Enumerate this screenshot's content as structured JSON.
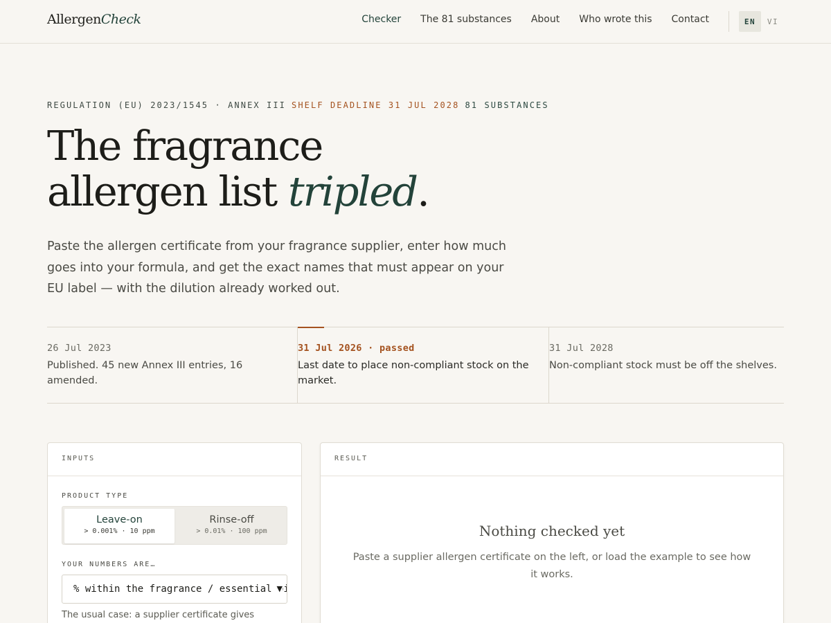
{
  "brand": {
    "name": "Allergen",
    "accent": "Check"
  },
  "nav": {
    "items": [
      {
        "label": "Checker",
        "active": true
      },
      {
        "label": "The 81 substances"
      },
      {
        "label": "About"
      },
      {
        "label": "Who wrote this"
      },
      {
        "label": "Contact"
      }
    ],
    "languages": [
      {
        "code": "EN",
        "selected": true
      },
      {
        "code": "VI"
      }
    ]
  },
  "hero": {
    "meta": {
      "regulation": "REGULATION (EU) 2023/1545 · ANNEX III",
      "deadline": "SHELF DEADLINE 31 JUL 2028",
      "count": "81 SUBSTANCES"
    },
    "title_line1": "The fragrance",
    "title_line2_prefix": "allergen list ",
    "title_italic": "tripled",
    "title_period": ".",
    "description": "Paste the allergen certificate from your fragrance supplier, enter how much goes into your formula, and get the exact names that must appear on your EU label — with the dilution already worked out."
  },
  "timeline": [
    {
      "date": "26 Jul 2023",
      "text": "Published. 45 new Annex III entries, 16 amended."
    },
    {
      "date": "31 Jul 2026 · passed",
      "text": "Last date to place non-compliant stock on the market."
    },
    {
      "date": "31 Jul 2028",
      "text": "Non-compliant stock must be off the shelves."
    }
  ],
  "inputs_panel": {
    "heading": "INPUTS",
    "product_type_label": "PRODUCT TYPE",
    "product_types": [
      {
        "title": "Leave-on",
        "threshold": "> 0.001% · 10 ppm",
        "selected": true
      },
      {
        "title": "Rinse-off",
        "threshold": "> 0.01% · 100 ppm"
      }
    ],
    "numbers_label": "YOUR NUMBERS ARE…",
    "numbers_select_value": "% within the fragrance / essential oil",
    "hint": "The usual case: a supplier certificate gives allergen"
  },
  "result_panel": {
    "heading": "RESULT",
    "empty_title": "Nothing checked yet",
    "empty_description": "Paste a supplier allergen certificate on the left, or load the example to see how it works."
  },
  "colors": {
    "background": "#f8f6f2",
    "accent_green": "#23433a",
    "accent_rust": "#a4521f"
  }
}
